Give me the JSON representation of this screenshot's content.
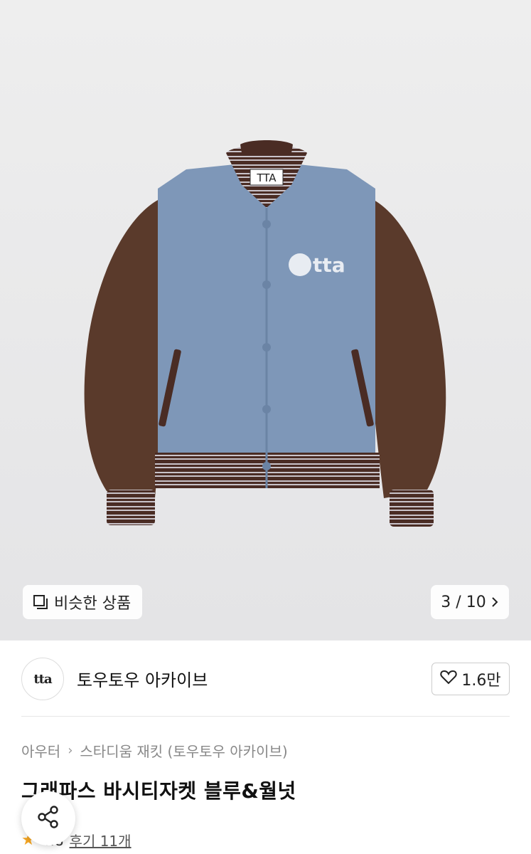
{
  "gallery": {
    "label_tag": "TTA",
    "chest_logo": "tta",
    "similar_label": "비슷한 상품",
    "counter": "3 / 10"
  },
  "seller": {
    "avatar_text": "tta",
    "name": "토우토우 아카이브",
    "likes": "1.6만"
  },
  "breadcrumb": [
    "아우터",
    "스타디움 재킷 (토우토우 아카이브)"
  ],
  "product": {
    "title": "그래파스 바시티자켓 블루&월넛",
    "rating": "4.8",
    "reviews": "후기 11개"
  },
  "colors": {
    "wool": "#7e97b8",
    "leather": "#5a3a2b",
    "rib": "#4a2c24"
  },
  "icons": [
    "copy-icon",
    "chevron-right-icon",
    "heart-icon",
    "share-icon",
    "star-icon"
  ]
}
